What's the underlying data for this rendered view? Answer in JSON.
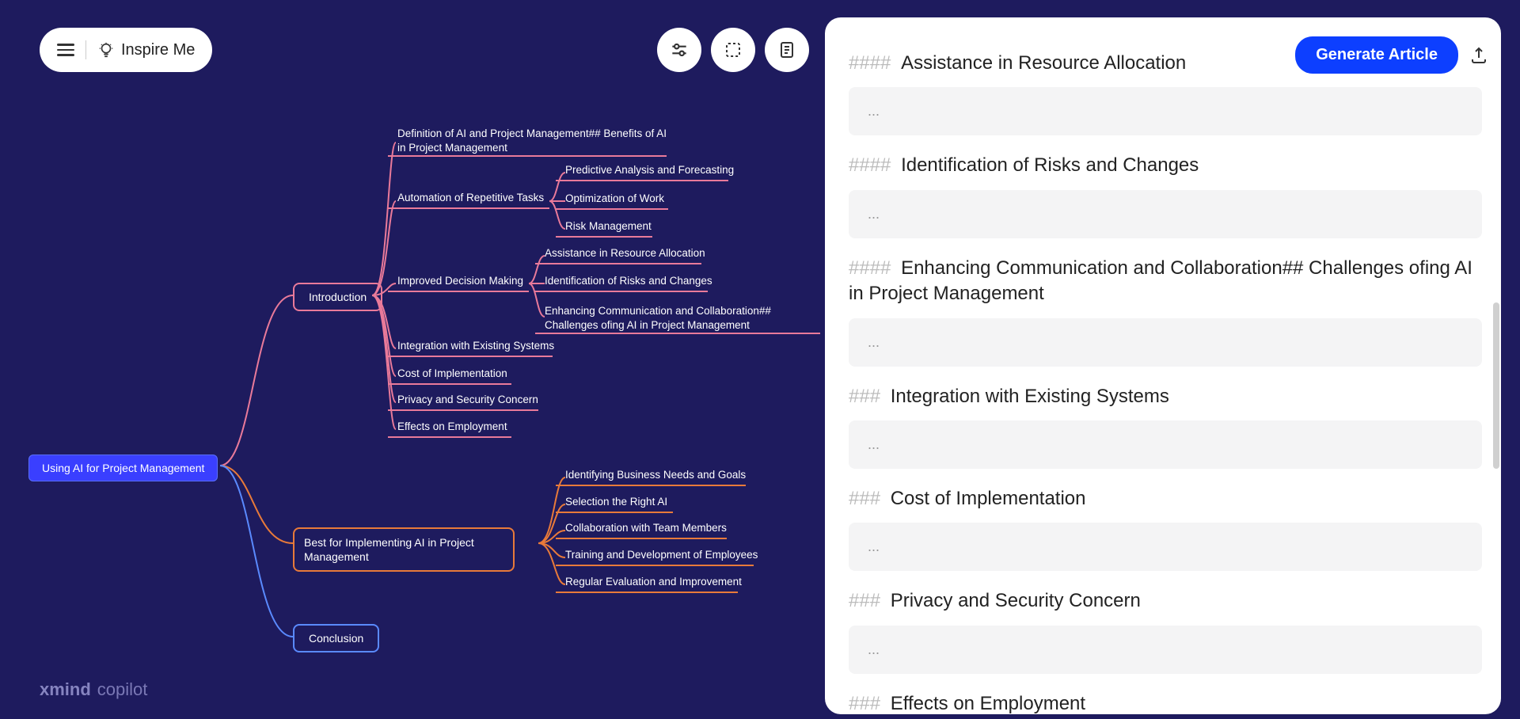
{
  "toolbar": {
    "inspire_label": "Inspire Me"
  },
  "panel": {
    "generate_label": "Generate Article",
    "placeholder": "...",
    "sections": [
      {
        "level": "####",
        "title": "Assistance in Resource Allocation"
      },
      {
        "level": "####",
        "title": "Identification of Risks and Changes"
      },
      {
        "level": "####",
        "title": "Enhancing Communication and Collaboration## Challenges ofing AI in Project Management"
      },
      {
        "level": "###",
        "title": "Integration with Existing Systems"
      },
      {
        "level": "###",
        "title": "Cost of Implementation"
      },
      {
        "level": "###",
        "title": "Privacy and Security Concern"
      },
      {
        "level": "###",
        "title": "Effects on Employment"
      }
    ]
  },
  "mindmap": {
    "root": "Using AI for Project Management",
    "branches": [
      {
        "label": "Introduction",
        "color": "pink",
        "children": [
          {
            "label": "Definition of AI and Project Management## Benefits of AI in Project Management",
            "wrap": true
          },
          {
            "label": "Automation of Repetitive Tasks",
            "children": [
              {
                "label": "Predictive Analysis and Forecasting"
              },
              {
                "label": "Optimization of Work"
              },
              {
                "label": "Risk Management"
              }
            ]
          },
          {
            "label": "Improved Decision Making",
            "children": [
              {
                "label": "Assistance in Resource Allocation"
              },
              {
                "label": "Identification of Risks and Changes"
              },
              {
                "label": "Enhancing Communication and Collaboration## Challenges ofing AI in Project Management",
                "wrap": true
              }
            ]
          },
          {
            "label": "Integration with Existing Systems"
          },
          {
            "label": "Cost of Implementation"
          },
          {
            "label": "Privacy and Security Concern"
          },
          {
            "label": "Effects on Employment"
          }
        ]
      },
      {
        "label": "Best for Implementing AI in Project Management",
        "color": "orange",
        "children": [
          {
            "label": "Identifying Business Needs and Goals"
          },
          {
            "label": "Selection the Right AI"
          },
          {
            "label": "Collaboration with Team Members"
          },
          {
            "label": "Training and Development of Employees"
          },
          {
            "label": "Regular Evaluation and Improvement"
          }
        ]
      },
      {
        "label": "Conclusion",
        "color": "blue",
        "children": []
      }
    ]
  },
  "logo": {
    "brand": "xmind",
    "product": "copilot"
  }
}
